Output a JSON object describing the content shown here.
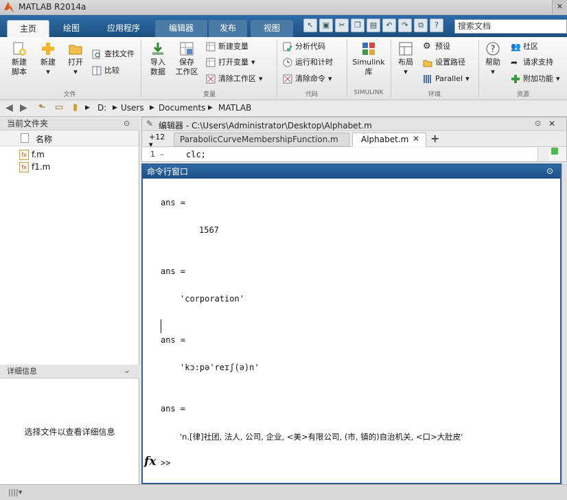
{
  "app": {
    "title": "MATLAB R2014a"
  },
  "tabs": [
    {
      "label": "主页",
      "active": true
    },
    {
      "label": "绘图"
    },
    {
      "label": "应用程序"
    },
    {
      "label": "编辑器"
    },
    {
      "label": "发布"
    },
    {
      "label": "视图"
    }
  ],
  "search": {
    "placeholder": "搜索文档"
  },
  "ribbon": {
    "new_script": "新建\n脚本",
    "new": "新建",
    "open": "打开",
    "find_files": "查找文件",
    "compare": "比较",
    "import_data": "导入\n数据",
    "save_workspace": "保存\n工作区",
    "new_variable": "新建变量",
    "open_variable": "打开变量",
    "clear_workspace": "清除工作区",
    "analyze_code": "分析代码",
    "run_and_time": "运行和计时",
    "clear_commands": "清除命令",
    "simulink": "Simulink\n库",
    "layout": "布局",
    "preferences": "预设",
    "set_path": "设置路径",
    "parallel": "Parallel",
    "help": "帮助",
    "community": "社区",
    "request_support": "请求支持",
    "add_ons": "附加功能",
    "groups": {
      "file": "文件",
      "variable": "变量",
      "code": "代码",
      "simulink": "SIMULINK",
      "environment": "环境",
      "resources": "资源"
    }
  },
  "address": {
    "parts": [
      "D:",
      "Users",
      "Documents",
      "MATLAB"
    ]
  },
  "current_folder": {
    "title": "当前文件夹",
    "column_name": "名称",
    "files": [
      "f.m",
      "f1.m"
    ]
  },
  "details": {
    "title": "详细信息",
    "empty_message": "选择文件以查看详细信息"
  },
  "editor": {
    "title": "编辑器 - C:\\Users\\Administrator\\Desktop\\Alphabet.m",
    "more_tabs": "+12",
    "tabs": [
      "ParabolicCurveMembershipFunction.m",
      "Alphabet.m"
    ],
    "add_tab": "+",
    "line_number": "1",
    "line_marker": "–",
    "line_code": "clc;"
  },
  "command_window": {
    "title": "命令行窗口",
    "blocks": [
      {
        "label": "ans =",
        "value": "1567"
      },
      {
        "label": "ans =",
        "value": "'corporation'"
      },
      {
        "label": "ans =",
        "value": "'kɔ:pə'reɪʃ(ə)n'"
      },
      {
        "label": "ans =",
        "value": "'n.[律]社团, 法人, 公司, 企业, <美>有限公司, (市, 镇的)自治机关, <口>大肚皮'"
      }
    ],
    "prompt": ">>",
    "fx": "fx"
  }
}
